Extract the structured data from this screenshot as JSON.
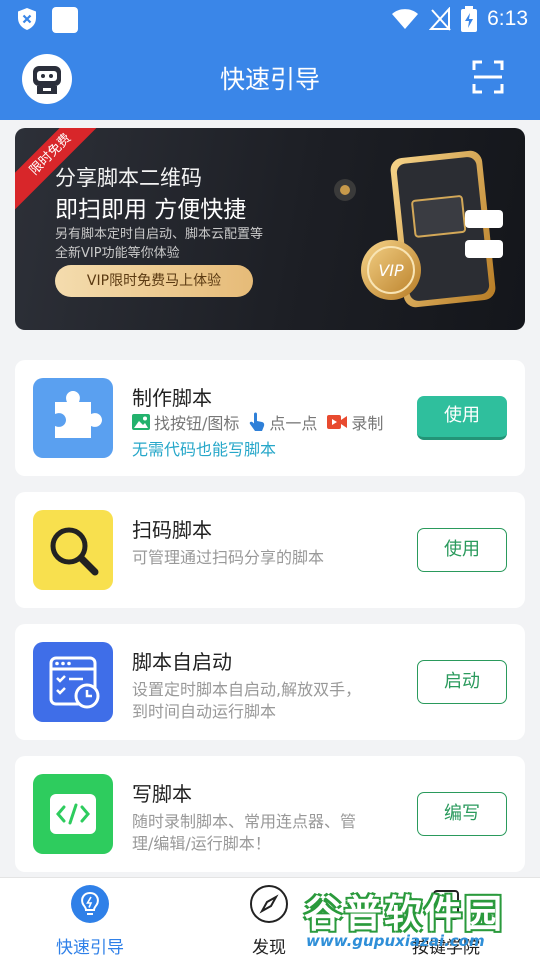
{
  "status_bar": {
    "time": "6:13"
  },
  "header": {
    "title": "快速引导"
  },
  "banner": {
    "ribbon": "限时免费",
    "headline_1": "分享脚本二维码",
    "headline_2": "即扫即用 方便快捷",
    "desc_1": "另有脚本定时自启动、脚本云配置等",
    "desc_2": "全新VIP功能等你体验",
    "cta": "VIP限时免费马上体验",
    "coin_text": "VIP"
  },
  "cards": [
    {
      "title": "制作脚本",
      "features": [
        "找按钮/图标",
        "点一点",
        "录制"
      ],
      "subtitle": "无需代码也能写脚本",
      "button": "使用",
      "icon": "puzzle-icon",
      "icon_color": "#5aa0f0"
    },
    {
      "title": "扫码脚本",
      "desc": "可管理通过扫码分享的脚本",
      "button": "使用",
      "icon": "magnifier-icon",
      "icon_color": "#f8e04e"
    },
    {
      "title": "脚本自启动",
      "desc": "设置定时脚本自启动,解放双手，到时间自动运行脚本",
      "button": "启动",
      "icon": "schedule-icon",
      "icon_color": "#3f6ee8"
    },
    {
      "title": "写脚本",
      "desc": "随时录制脚本、常用连点器、管理/编辑/运行脚本！",
      "button": "编写",
      "icon": "code-icon",
      "icon_color": "#2ecc5e"
    }
  ],
  "bottom_nav": [
    {
      "label": "快速引导",
      "icon": "lightbulb-icon",
      "active": true
    },
    {
      "label": "发现",
      "icon": "compass-icon",
      "active": false
    },
    {
      "label": "按键学院",
      "icon": "book-icon",
      "active": false
    }
  ],
  "watermark": {
    "text_1": "谷普软件园",
    "text_2": "www.gupuxiazai.com"
  },
  "colors": {
    "primary": "#3a86e8",
    "accent_green": "#2a9a5c",
    "teal": "#2fbf9d"
  }
}
